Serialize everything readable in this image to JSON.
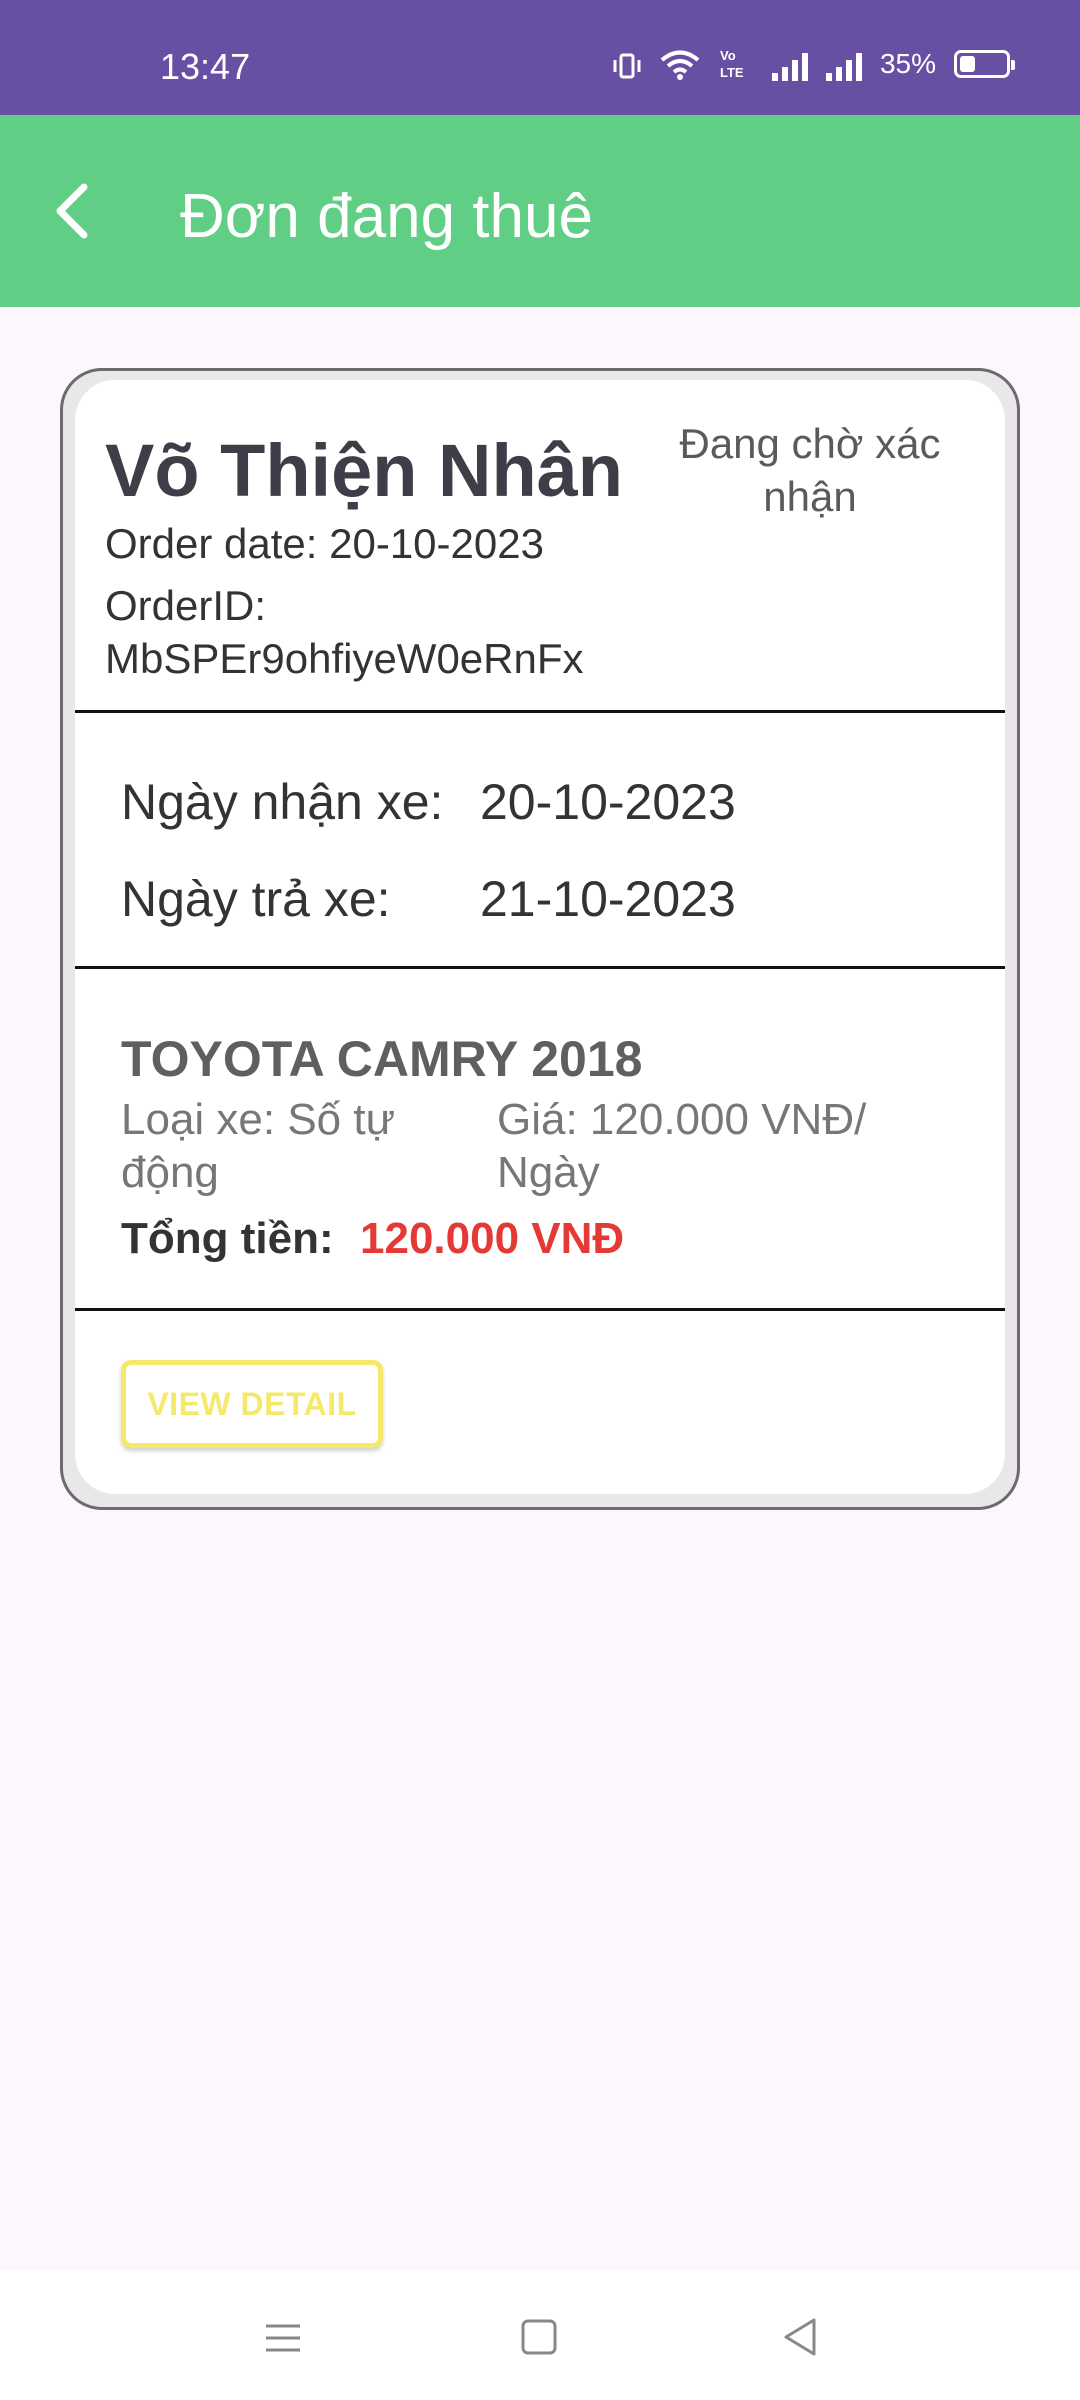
{
  "status_bar": {
    "time": "13:47",
    "battery_percent": "35%",
    "battery_level": 0.35,
    "icons": [
      "vibrate-icon",
      "wifi-icon",
      "volte-icon",
      "signal-icon",
      "signal-icon",
      "battery-icon"
    ],
    "background": "#6750A4"
  },
  "app_bar": {
    "title": "Đơn đang thuê",
    "back_icon": "chevron-left-icon",
    "background": "#60CF85"
  },
  "order": {
    "customer_name": "Võ Thiện Nhân",
    "status": "Đang chờ xác nhận",
    "order_date": "Order date: 20-10-2023",
    "order_id": "OrderID: MbSPEr9ohfiyeW0eRnFx",
    "pickup_label": "Ngày nhận xe:",
    "pickup_value": "20-10-2023",
    "return_label": "Ngày trả xe:",
    "return_value": "21-10-2023",
    "car_name": "TOYOTA CAMRY 2018",
    "car_type": "Loại xe: Số tự động",
    "price": "Giá: 120.000 VNĐ/ Ngày",
    "total_label": "Tổng tiền:",
    "total_value": "120.000 VNĐ",
    "total_color": "#E53935",
    "view_detail_label": "VIEW DETAIL",
    "view_detail_color": "#F5E96B"
  },
  "nav_bar": {
    "icons": [
      "menu-icon",
      "home-icon",
      "back-icon"
    ]
  }
}
